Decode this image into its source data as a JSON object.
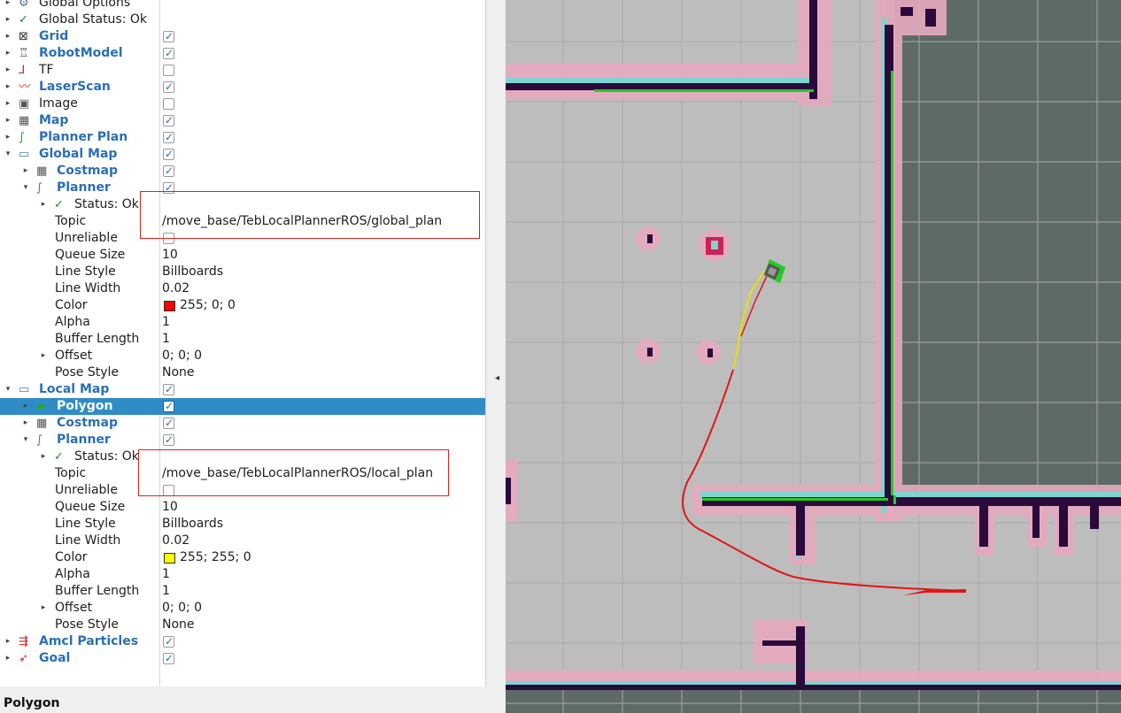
{
  "display_tree": {
    "rows": [
      {
        "name": "Global Options",
        "arrow": "▸",
        "icon": "gear-icon",
        "style": "plain",
        "value": "",
        "check": null
      },
      {
        "name": "Global Status: Ok",
        "arrow": "▸",
        "icon": "check-icon",
        "style": "plain",
        "value": "",
        "check": null
      },
      {
        "name": "Grid",
        "arrow": "▸",
        "icon": "grid-icon",
        "style": "disp",
        "value": "",
        "check": true
      },
      {
        "name": "RobotModel",
        "arrow": "▸",
        "icon": "robot-icon",
        "style": "disp",
        "value": "",
        "check": true
      },
      {
        "name": "TF",
        "arrow": "▸",
        "icon": "tf-icon",
        "style": "plain",
        "value": "",
        "check": false
      },
      {
        "name": "LaserScan",
        "arrow": "▸",
        "icon": "laserscan-icon",
        "style": "disp",
        "value": "",
        "check": true
      },
      {
        "name": "Image",
        "arrow": "▸",
        "icon": "image-icon",
        "style": "plain",
        "value": "",
        "check": false
      },
      {
        "name": "Map",
        "arrow": "▸",
        "icon": "map-icon",
        "style": "disp",
        "value": "",
        "check": true
      },
      {
        "name": "Planner Plan",
        "arrow": "▸",
        "icon": "path-icon",
        "style": "disp",
        "value": "",
        "check": true
      },
      {
        "name": "Global Map",
        "arrow": "▾",
        "icon": "folder-icon",
        "style": "disp",
        "value": "",
        "check": true
      },
      {
        "name": "Costmap",
        "arrow": "▸",
        "icon": "map-icon",
        "style": "disp",
        "value": "",
        "check": true,
        "indent": 1
      },
      {
        "name": "Planner",
        "arrow": "▾",
        "icon": "path-icon",
        "style": "disp",
        "value": "",
        "check": true,
        "indent": 1
      },
      {
        "name": "Status: Ok",
        "arrow": "▸",
        "icon": "check-icon",
        "style": "plain",
        "value": "",
        "check": null,
        "indent": 2
      },
      {
        "name": "Topic",
        "arrow": "",
        "icon": "",
        "style": "plain",
        "value": "/move_base/TebLocalPlannerROS/global_plan",
        "check": null,
        "indent": 2
      },
      {
        "name": "Unreliable",
        "arrow": "",
        "icon": "",
        "style": "plain",
        "value": "",
        "check": false,
        "indent": 2
      },
      {
        "name": "Queue Size",
        "arrow": "",
        "icon": "",
        "style": "plain",
        "value": "10",
        "check": null,
        "indent": 2
      },
      {
        "name": "Line Style",
        "arrow": "",
        "icon": "",
        "style": "plain",
        "value": "Billboards",
        "check": null,
        "indent": 2
      },
      {
        "name": "Line Width",
        "arrow": "",
        "icon": "",
        "style": "plain",
        "value": "0.02",
        "check": null,
        "indent": 2
      },
      {
        "name": "Color",
        "arrow": "",
        "icon": "",
        "style": "plain",
        "value": "255; 0; 0",
        "swatch": "#ff0000",
        "check": null,
        "indent": 2
      },
      {
        "name": "Alpha",
        "arrow": "",
        "icon": "",
        "style": "plain",
        "value": "1",
        "check": null,
        "indent": 2
      },
      {
        "name": "Buffer Length",
        "arrow": "",
        "icon": "",
        "style": "plain",
        "value": "1",
        "check": null,
        "indent": 2
      },
      {
        "name": "Offset",
        "arrow": "▸",
        "icon": "",
        "style": "plain",
        "value": "0; 0; 0",
        "check": null,
        "indent": 2
      },
      {
        "name": "Pose Style",
        "arrow": "",
        "icon": "",
        "style": "plain",
        "value": "None",
        "check": null,
        "indent": 2
      },
      {
        "name": "Local Map",
        "arrow": "▾",
        "icon": "folder-icon",
        "style": "disp",
        "value": "",
        "check": true
      },
      {
        "name": "Polygon",
        "arrow": "▸",
        "icon": "polygon-icon",
        "style": "disp",
        "value": "",
        "check": true,
        "indent": 1,
        "selected": true
      },
      {
        "name": "Costmap",
        "arrow": "▸",
        "icon": "map-icon",
        "style": "disp",
        "value": "",
        "check": true,
        "indent": 1
      },
      {
        "name": "Planner",
        "arrow": "▾",
        "icon": "path-icon",
        "style": "disp",
        "value": "",
        "check": true,
        "indent": 1
      },
      {
        "name": "Status: Ok",
        "arrow": "▸",
        "icon": "check-icon",
        "style": "plain",
        "value": "",
        "check": null,
        "indent": 2
      },
      {
        "name": "Topic",
        "arrow": "",
        "icon": "",
        "style": "plain",
        "value": "/move_base/TebLocalPlannerROS/local_plan",
        "check": null,
        "indent": 2
      },
      {
        "name": "Unreliable",
        "arrow": "",
        "icon": "",
        "style": "plain",
        "value": "",
        "check": false,
        "indent": 2
      },
      {
        "name": "Queue Size",
        "arrow": "",
        "icon": "",
        "style": "plain",
        "value": "10",
        "check": null,
        "indent": 2
      },
      {
        "name": "Line Style",
        "arrow": "",
        "icon": "",
        "style": "plain",
        "value": "Billboards",
        "check": null,
        "indent": 2
      },
      {
        "name": "Line Width",
        "arrow": "",
        "icon": "",
        "style": "plain",
        "value": "0.02",
        "check": null,
        "indent": 2
      },
      {
        "name": "Color",
        "arrow": "",
        "icon": "",
        "style": "plain",
        "value": "255; 255; 0",
        "swatch": "#ffff00",
        "check": null,
        "indent": 2
      },
      {
        "name": "Alpha",
        "arrow": "",
        "icon": "",
        "style": "plain",
        "value": "1",
        "check": null,
        "indent": 2
      },
      {
        "name": "Buffer Length",
        "arrow": "",
        "icon": "",
        "style": "plain",
        "value": "1",
        "check": null,
        "indent": 2
      },
      {
        "name": "Offset",
        "arrow": "▸",
        "icon": "",
        "style": "plain",
        "value": "0; 0; 0",
        "check": null,
        "indent": 2
      },
      {
        "name": "Pose Style",
        "arrow": "",
        "icon": "",
        "style": "plain",
        "value": "None",
        "check": null,
        "indent": 2
      },
      {
        "name": "Amcl Particles",
        "arrow": "▸",
        "icon": "particles-icon",
        "style": "disp",
        "value": "",
        "check": true
      },
      {
        "name": "Goal",
        "arrow": "▸",
        "icon": "goal-icon",
        "style": "disp",
        "value": "",
        "check": true
      }
    ]
  },
  "status_bar": {
    "text": "Polygon"
  },
  "colors": {
    "selection": "#308cc6",
    "display_name": "#2a6fb5",
    "highlight_box": "#e02020",
    "global_plan": "#ff0000",
    "local_plan": "#ffff00",
    "map_free": "#bdbdbd",
    "map_unknown": "#5d6a66",
    "wall": "#2a0a3a",
    "inflation": "#e6aabe",
    "laser": "#22cc22"
  }
}
